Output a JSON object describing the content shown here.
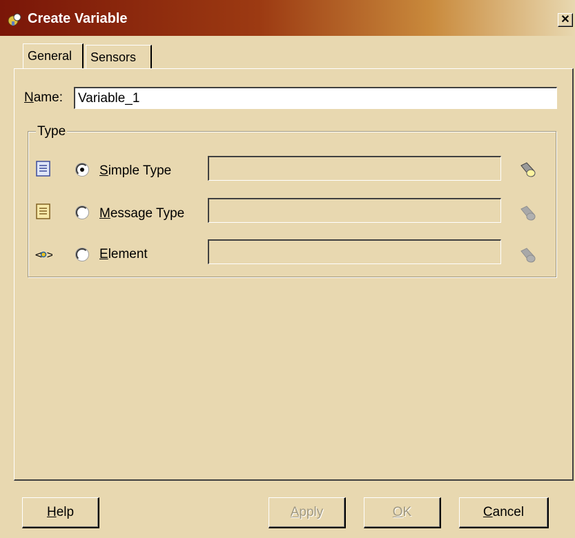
{
  "window": {
    "title": "Create Variable",
    "close_glyph": "✕",
    "title_icon": "bpel-variable-icon"
  },
  "tabs": [
    {
      "label": "General",
      "selected": true
    },
    {
      "label": "Sensors",
      "selected": false
    }
  ],
  "name_field": {
    "label_hotkey": "N",
    "label_rest": "ame:",
    "value": "Variable_1"
  },
  "type_group": {
    "label": "Type",
    "options": [
      {
        "hotkey": "S",
        "rest": "imple Type",
        "selected": true,
        "icon": "simple-type-icon",
        "browse_enabled": true
      },
      {
        "hotkey": "M",
        "rest": "essage Type",
        "selected": false,
        "icon": "message-type-icon",
        "browse_enabled": false
      },
      {
        "hotkey": "E",
        "rest": "lement",
        "selected": false,
        "icon": "element-icon",
        "browse_enabled": false
      }
    ]
  },
  "buttons": {
    "help": {
      "hotkey": "H",
      "rest": "elp"
    },
    "apply": {
      "hotkey": "A",
      "rest": "pply",
      "enabled": false
    },
    "ok": {
      "hotkey": "O",
      "rest": "K",
      "enabled": false
    },
    "cancel": {
      "hotkey": "C",
      "rest": "ancel"
    }
  },
  "colors": {
    "dialog_bg": "#e8d8b0",
    "titlebar_start": "#7a1608",
    "disabled_text": "#a09880"
  }
}
